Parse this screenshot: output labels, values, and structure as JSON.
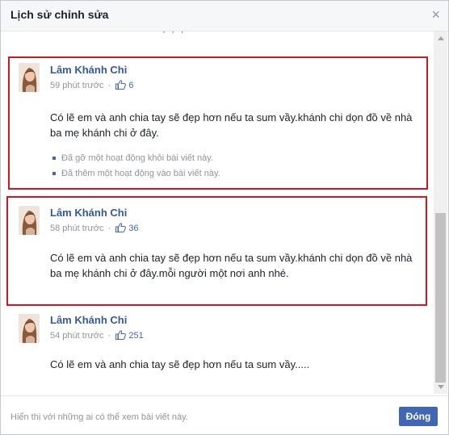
{
  "dialog": {
    "title": "Lịch sử chỉnh sửa",
    "close_glyph": "×",
    "top_cut_text": "·  ·  ·"
  },
  "entries": [
    {
      "author": "Lâm Khánh Chi",
      "time": "59 phút trước",
      "separator": "·",
      "likes": "6",
      "text": "Có lẽ em và anh chia tay sẽ đẹp hơn nếu ta sum vầy.khánh chi dọn đồ về nhà ba mẹ khánh chi ở đây.",
      "changes": [
        "Đã gỡ một hoạt động khỏi bài viết này.",
        "Đã thêm một hoạt động vào bài viết này."
      ],
      "highlighted": true
    },
    {
      "author": "Lâm Khánh Chi",
      "time": "58 phút trước",
      "separator": "·",
      "likes": "36",
      "text": "Có lẽ em và anh chia tay sẽ đẹp hơn nếu ta sum vầy.khánh chi dọn đồ về nhà ba mẹ khánh chi ở đây.mỗi người một nơi anh nhé.",
      "highlighted": true
    },
    {
      "author": "Lâm Khánh Chi",
      "time": "54 phút trước",
      "separator": "·",
      "likes": "251",
      "text": "Có lẽ em và anh chia tay sẽ đẹp hơn nếu ta sum vầy.....",
      "highlighted": false
    }
  ],
  "footer": {
    "visibility_text": "Hiển thị với những ai có thể xem bài viết này.",
    "close_label": "Đóng"
  },
  "icons": {
    "like": "thumbs-up-icon",
    "close": "close-icon",
    "avatar": "profile-photo"
  },
  "colors": {
    "name_link": "#365899",
    "primary_button": "#4267b2",
    "highlight_border": "#d2171e",
    "muted_text": "#90949c"
  }
}
